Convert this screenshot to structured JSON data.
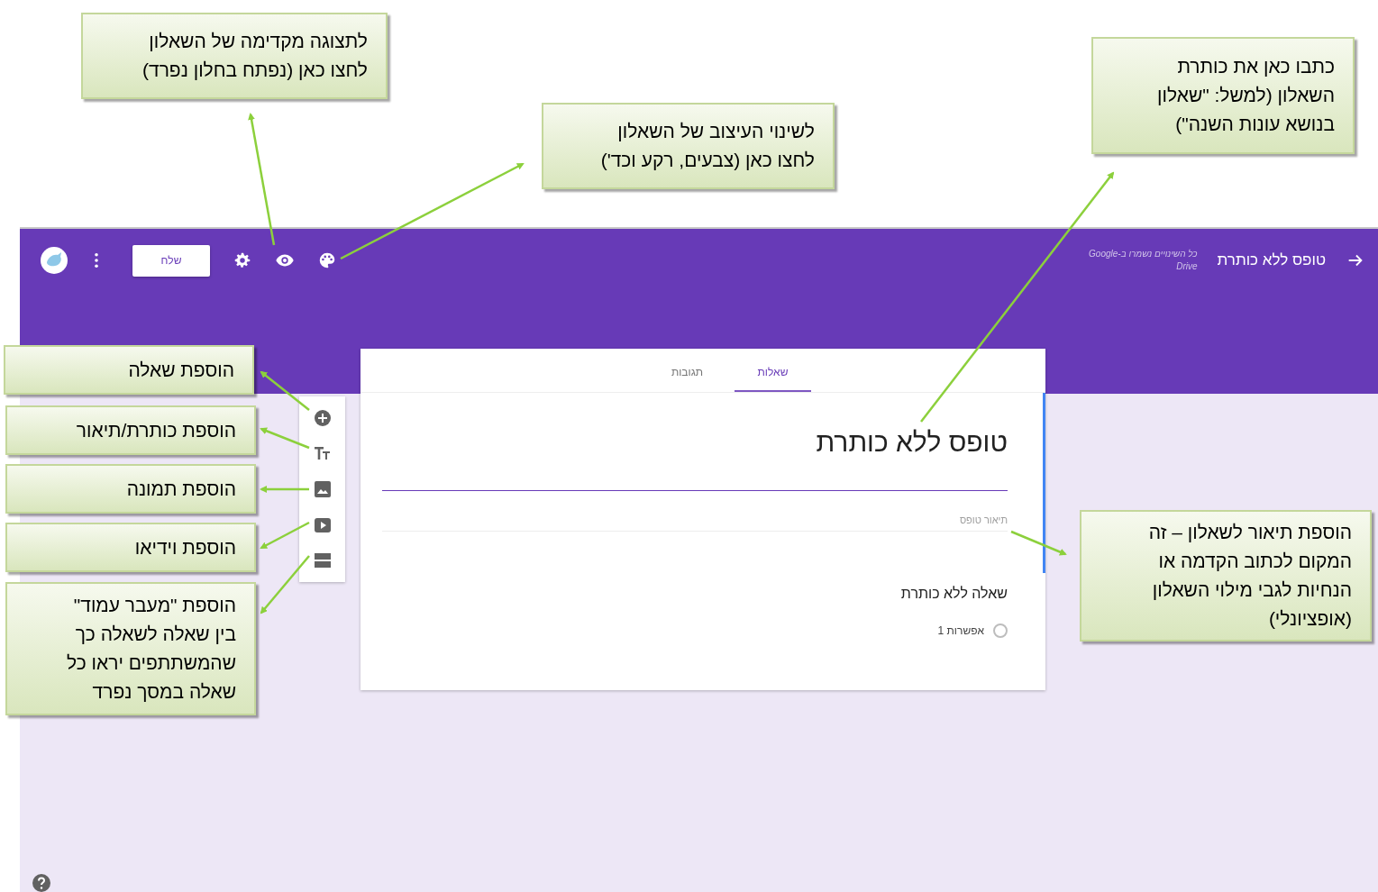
{
  "header": {
    "title": "טופס ללא כותרת",
    "save_status": [
      "כל השינויים נשמרו ב-Google",
      "Drive"
    ],
    "send_button": "שלח"
  },
  "tabs": [
    {
      "label": "שאלות",
      "selected": true
    },
    {
      "label": "תגובות",
      "selected": false
    }
  ],
  "form": {
    "title": "טופס ללא כותרת",
    "description_placeholder": "תיאור טופס",
    "question": {
      "title": "שאלה ללא כותרת",
      "options": [
        {
          "label": "אפשרות 1",
          "selected": false
        }
      ]
    }
  },
  "callouts": [
    {
      "lines": [
        "לתצוגה מקדימה של השאלון",
        "לחצו כאן (נפתח בחלון נפרד)"
      ]
    },
    {
      "lines": [
        "לשינוי העיצוב של השאלון",
        "לחצו כאן (צבעים, רקע וכד')"
      ]
    },
    {
      "lines": [
        "כתבו כאן את כותרת",
        "השאלון (למשל: \"שאלון",
        "בנושא עונות השנה\")"
      ]
    },
    {
      "lines": [
        "הוספת שאלה"
      ]
    },
    {
      "lines": [
        "הוספת כותרת/תיאור"
      ]
    },
    {
      "lines": [
        "הוספת תמונה"
      ]
    },
    {
      "lines": [
        "הוספת וידיאו"
      ]
    },
    {
      "lines": [
        "הוספת \"מעבר עמוד\"",
        "בין שאלה לשאלה כך",
        "שהמשתתפים יראו כל",
        "שאלה במסך נפרד"
      ]
    },
    {
      "lines": [
        "הוספת תיאור לשאלון – זה",
        "המקום לכתוב הקדמה או",
        "הנחיות לגבי מילוי השאלון",
        "(אופציונלי)"
      ]
    }
  ]
}
